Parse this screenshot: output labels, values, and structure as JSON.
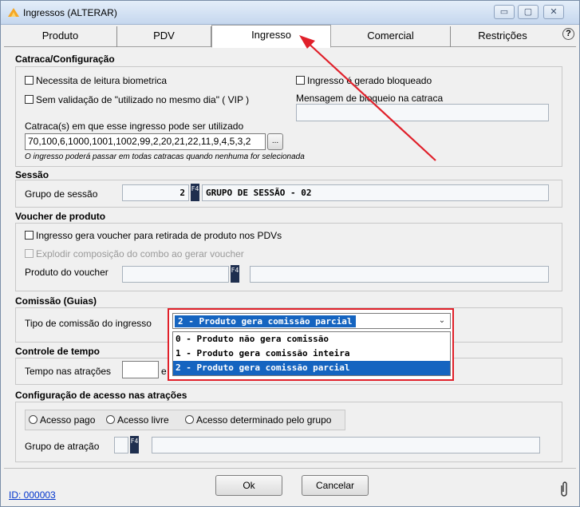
{
  "window": {
    "title": "Ingressos (ALTERAR)",
    "minimize": "▭",
    "maximize": "▢",
    "close": "✕"
  },
  "tabs": [
    {
      "label": "Produto"
    },
    {
      "label": "PDV"
    },
    {
      "label": "Ingresso"
    },
    {
      "label": "Comercial"
    },
    {
      "label": "Restrições"
    }
  ],
  "help_icon": "?",
  "catraca": {
    "title": "Catraca/Configuração",
    "biometria": "Necessita de leitura biometrica",
    "vip": "Sem validação de \"utilizado no mesmo dia\" ( VIP )",
    "bloqueado": "Ingresso é gerado bloqueado",
    "msg_bloqueio_label": "Mensagem de bloqueio na catraca",
    "catracas_label": "Catraca(s) em que esse ingresso pode ser utilizado",
    "catracas_value": "70,100,6,1000,1001,1002,99,2,20,21,22,11,9,4,5,3,2",
    "ellipsis": "...",
    "hint": "O ingresso poderá passar em todas catracas quando nenhuma for selecionada"
  },
  "sessao": {
    "title": "Sessão",
    "grupo_label": "Grupo de sessão",
    "grupo_code": "2",
    "grupo_name": "GRUPO DE SESSÃO - 02",
    "f4": "F4"
  },
  "voucher": {
    "title": "Voucher de produto",
    "gera_voucher": "Ingresso gera voucher para retirada de produto nos PDVs",
    "explodir": "Explodir composição do combo ao gerar voucher",
    "produto_label": "Produto do voucher"
  },
  "comissao": {
    "title": "Comissão (Guias)",
    "tipo_label": "Tipo de comissão do ingresso",
    "selected": "2 - Produto gera comissão parcial",
    "options": [
      "0 - Produto não gera comissão",
      "1 - Produto gera comissão inteira",
      "2 - Produto gera comissão parcial"
    ]
  },
  "tempo": {
    "title": "Controle de tempo",
    "label": "Tempo nas atrações",
    "suffix": "e"
  },
  "acesso": {
    "title": "Configuração de acesso nas atrações",
    "pago": "Acesso pago",
    "livre": "Acesso livre",
    "grupo": "Acesso determinado pelo grupo",
    "grupo_atracao_label": "Grupo de atração"
  },
  "footer": {
    "id_link": "ID: 000003",
    "ok": "Ok",
    "cancelar": "Cancelar"
  },
  "colors": {
    "annotation": "#e0202a",
    "selection": "#1564c0"
  }
}
